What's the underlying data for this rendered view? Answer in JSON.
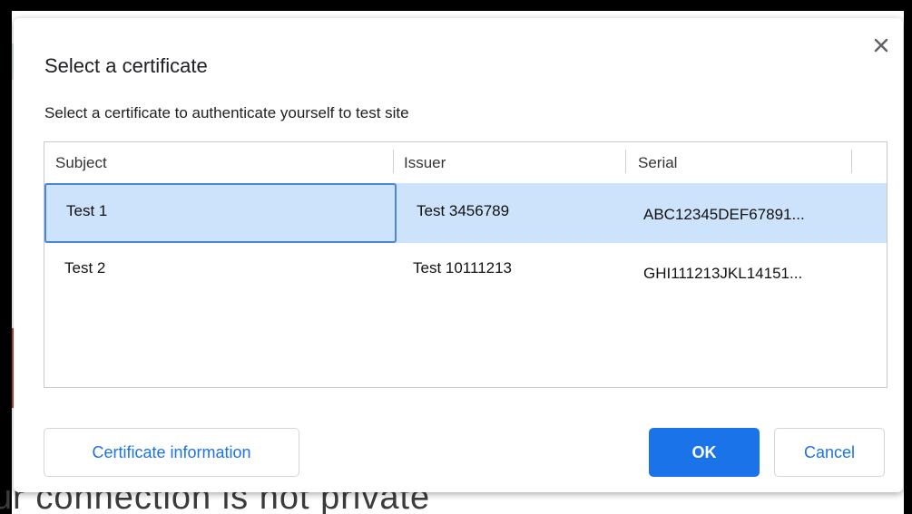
{
  "background": {
    "text": "ur connection is not private"
  },
  "dialog": {
    "title": "Select a certificate",
    "subtitle_prefix": "Select a certificate to authenticate yourself to ",
    "site": "test site",
    "close_icon": "close-icon"
  },
  "table": {
    "headers": [
      "Subject",
      "Issuer",
      "Serial"
    ],
    "rows": [
      {
        "subject": "Test 1",
        "issuer": "Test 3456789",
        "serial": "ABC12345DEF67891...",
        "selected": true
      },
      {
        "subject": "Test 2",
        "issuer": "Test 10111213",
        "serial": "GHI111213JKL14151...",
        "selected": false
      }
    ]
  },
  "buttons": {
    "info": "Certificate information",
    "ok": "OK",
    "cancel": "Cancel"
  },
  "colors": {
    "accent": "#1a73e8",
    "selection": "#cde3fb",
    "focus_border": "#4a86d6"
  }
}
